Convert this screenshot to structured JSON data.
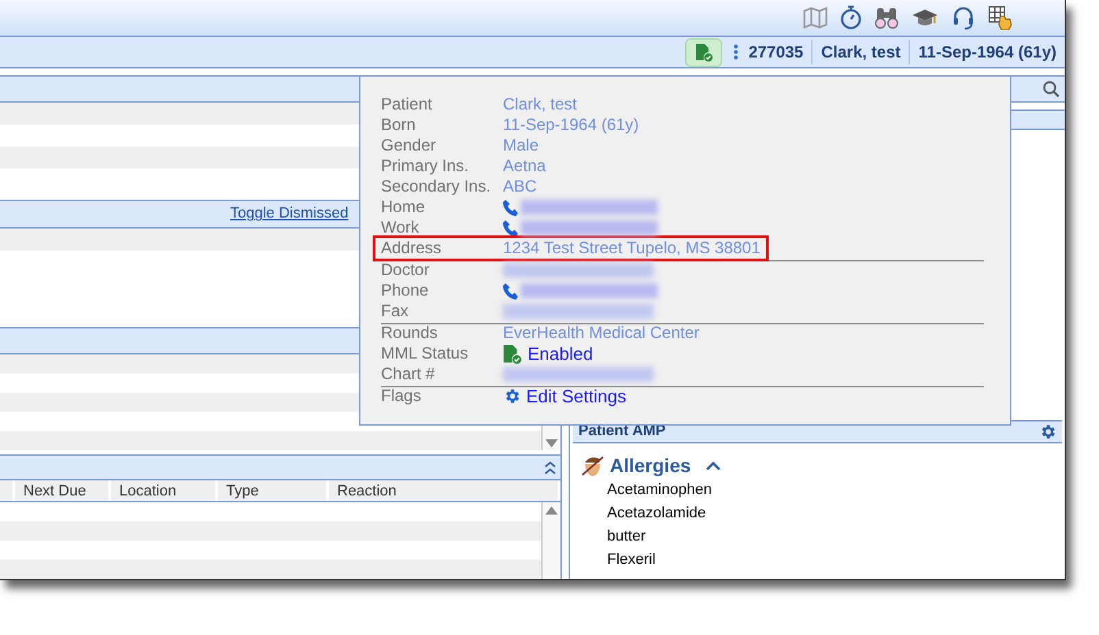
{
  "patient_bar": {
    "chart_number": "277035",
    "name": "Clark, test",
    "born": "11-Sep-1964 (61y)"
  },
  "left_panel": {
    "toggle_link": "Toggle Dismissed",
    "table_columns": [
      "Next Due",
      "Location",
      "Type",
      "Reaction"
    ]
  },
  "right_panel": {
    "amp_title": "Patient AMP",
    "allergies": {
      "title": "Allergies",
      "expanded": true,
      "items": [
        "Acetaminophen",
        "Acetazolamide",
        "butter",
        "Flexeril"
      ]
    }
  },
  "popup": {
    "rows": [
      {
        "label": "Patient",
        "kind": "text",
        "value": "Clark, test",
        "highlighted": false,
        "divider_after": false
      },
      {
        "label": "Born",
        "kind": "text",
        "value": "11-Sep-1964 (61y)",
        "highlighted": false,
        "divider_after": false
      },
      {
        "label": "Gender",
        "kind": "text",
        "value": "Male",
        "highlighted": false,
        "divider_after": false
      },
      {
        "label": "Primary Ins.",
        "kind": "text",
        "value": "Aetna",
        "highlighted": false,
        "divider_after": false
      },
      {
        "label": "Secondary Ins.",
        "kind": "text",
        "value": "ABC",
        "highlighted": false,
        "divider_after": false
      },
      {
        "label": "Home",
        "kind": "phone",
        "highlighted": false,
        "divider_after": false
      },
      {
        "label": "Work",
        "kind": "phone",
        "highlighted": false,
        "divider_after": false
      },
      {
        "label": "Address",
        "kind": "text",
        "value": "1234 Test Street Tupelo, MS 38801",
        "highlighted": true,
        "divider_after": true
      },
      {
        "label": "Doctor",
        "kind": "redacted",
        "highlighted": false,
        "divider_after": false
      },
      {
        "label": "Phone",
        "kind": "phone",
        "highlighted": false,
        "divider_after": false
      },
      {
        "label": "Fax",
        "kind": "redacted",
        "highlighted": false,
        "divider_after": true
      },
      {
        "label": "Rounds",
        "kind": "text",
        "value": "EverHealth Medical Center",
        "highlighted": false,
        "divider_after": false
      },
      {
        "label": "MML Status",
        "kind": "status",
        "value": "Enabled",
        "highlighted": false,
        "divider_after": false
      },
      {
        "label": "Chart #",
        "kind": "redacted",
        "highlighted": false,
        "divider_after": true
      },
      {
        "label": "Flags",
        "kind": "link",
        "value": "Edit Settings",
        "highlighted": false,
        "divider_after": false
      }
    ]
  }
}
